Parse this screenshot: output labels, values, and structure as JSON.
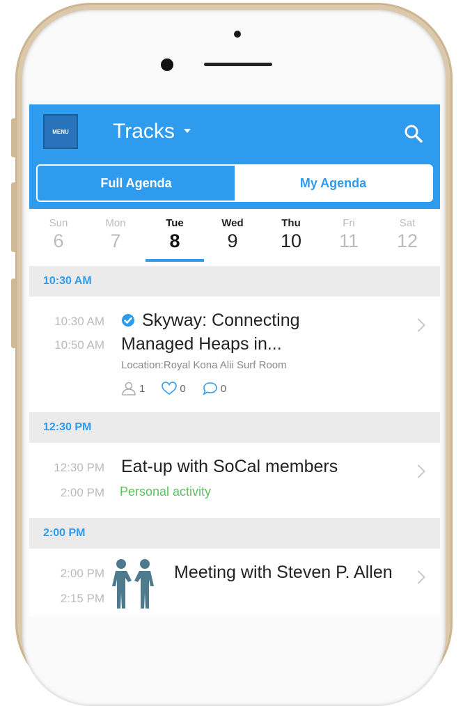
{
  "header": {
    "menu_label": "MENU",
    "title": "Tracks",
    "tabs": [
      {
        "label": "Full Agenda",
        "active": true
      },
      {
        "label": "My Agenda",
        "active": false
      }
    ]
  },
  "days": [
    {
      "name": "Sun",
      "num": "6"
    },
    {
      "name": "Mon",
      "num": "7"
    },
    {
      "name": "Tue",
      "num": "8",
      "selected": true
    },
    {
      "name": "Wed",
      "num": "9"
    },
    {
      "name": "Thu",
      "num": "10"
    },
    {
      "name": "Fri",
      "num": "11"
    },
    {
      "name": "Sat",
      "num": "12"
    }
  ],
  "sections": [
    {
      "header": "10:30 AM",
      "event": {
        "start": "10:30 AM",
        "end": "10:50 AM",
        "title_line1": "Skyway: Connecting",
        "title_line2": "Managed Heaps in...",
        "location": "Location:Royal Kona Alii Surf Room",
        "attendees": "1",
        "likes": "0",
        "comments": "0",
        "verified": true
      }
    },
    {
      "header": "12:30 PM",
      "event": {
        "start": "12:30 PM",
        "end": "2:00 PM",
        "title": "Eat-up with SoCal members",
        "subtitle": "Personal activity"
      }
    },
    {
      "header": "2:00 PM",
      "event": {
        "start": "2:00 PM",
        "end": "2:15 PM",
        "title": "Meeting with Steven P. Allen",
        "icon": "meeting-people-icon"
      }
    }
  ],
  "colors": {
    "accent": "#2f9bee",
    "personal": "#5cc15c",
    "frame": "#dcc9ac"
  }
}
